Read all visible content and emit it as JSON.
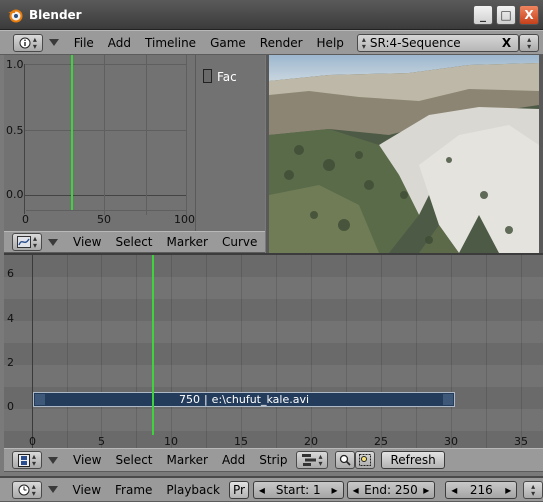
{
  "window": {
    "title": "Blender",
    "controls": {
      "minimize": "_",
      "maximize": "□",
      "close": "X"
    }
  },
  "menubar": {
    "items": [
      "File",
      "Add",
      "Timeline",
      "Game",
      "Render",
      "Help"
    ],
    "scene_selector": {
      "prefix": "SR:4-",
      "name": "Sequence",
      "clear": "X"
    }
  },
  "ipo_editor": {
    "y_ticks": [
      "1.0",
      "0.5",
      "0.0"
    ],
    "x_ticks": [
      "0",
      "50",
      "100"
    ],
    "channel_label": "Fac",
    "current_frame_color": "#3fd23f",
    "header": {
      "menus": [
        "View",
        "Select",
        "Marker",
        "Curve"
      ]
    }
  },
  "preview": {
    "description_icon": "video-preview-image"
  },
  "sequencer": {
    "y_ticks": [
      "6",
      "4",
      "2",
      "0"
    ],
    "x_ticks": [
      "0",
      "5",
      "10",
      "15",
      "20",
      "25",
      "30",
      "35"
    ],
    "strip": {
      "length": "750",
      "separator": "|",
      "file": "e:\\chufut_kale.avi",
      "fill": "#233c5c"
    },
    "header": {
      "menus": [
        "View",
        "Select",
        "Marker",
        "Add",
        "Strip"
      ],
      "refresh_label": "Refresh"
    }
  },
  "timeline": {
    "menus": [
      "View",
      "Frame",
      "Playback"
    ],
    "pr_label": "Pr",
    "start_label": "Start: 1",
    "end_label": "End: 250",
    "current_frame": "216"
  }
}
